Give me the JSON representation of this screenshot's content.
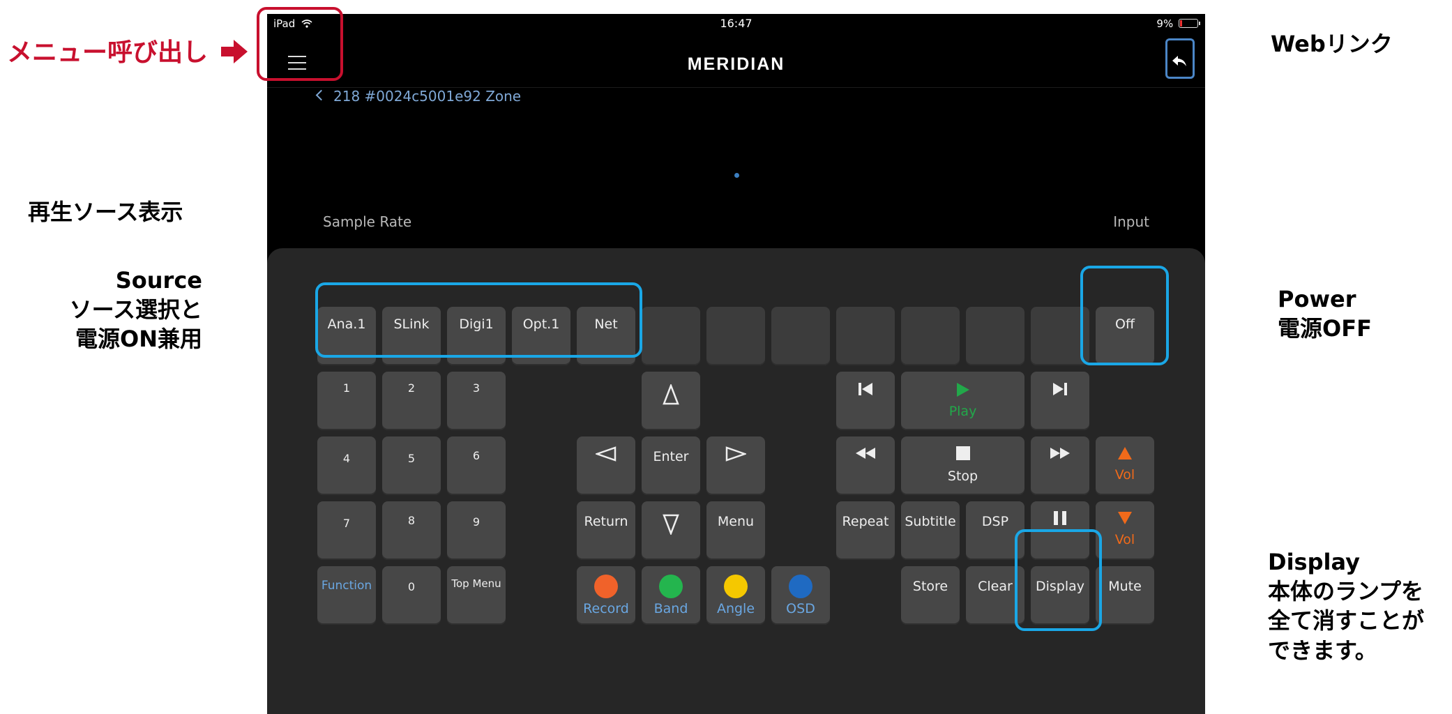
{
  "annotations": {
    "menu": "メニュー呼び出し",
    "web_link": "Webリンク",
    "source_display": "再生ソース表示",
    "source_lines": [
      "Source",
      "ソース選択と",
      "電源ON兼用"
    ],
    "power_lines": [
      "Power",
      "電源OFF"
    ],
    "display_lines": [
      "Display",
      "本体のランプを",
      "全て消すことが",
      "できます。"
    ]
  },
  "status": {
    "device": "iPad",
    "time": "16:47",
    "battery": "9%"
  },
  "navbar": {
    "brand": "MERIDIAN"
  },
  "breadcrumb": "218 #0024c5001e92 Zone",
  "labels": {
    "sample_rate": "Sample Rate",
    "input": "Input"
  },
  "keys": {
    "ana1": "Ana.1",
    "slink": "SLink",
    "digi1": "Digi1",
    "opt1": "Opt.1",
    "net": "Net",
    "off": "Off",
    "n1": "1",
    "n2": "2",
    "n3": "3",
    "n4": "4",
    "n5": "5",
    "n6": "6",
    "n7": "7",
    "n8": "8",
    "n9": "9",
    "n0": "0",
    "function": "Function",
    "top_menu": "Top Menu",
    "enter": "Enter",
    "return": "Return",
    "menu": "Menu",
    "play": "Play",
    "stop": "Stop",
    "vol_up": "Vol",
    "vol_down": "Vol",
    "repeat": "Repeat",
    "subtitle": "Subtitle",
    "dsp": "DSP",
    "store": "Store",
    "clear": "Clear",
    "display": "Display",
    "mute": "Mute",
    "record": "Record",
    "band": "Band",
    "angle": "Angle",
    "osd": "OSD"
  },
  "colors": {
    "highlight": "#1aa7e6",
    "menu_highlight": "#c8102e",
    "play_green": "#22a84a",
    "vol_orange": "#f06a1a",
    "record": "#f0622a",
    "band": "#24b54e",
    "angle": "#f5c800",
    "osd": "#1f6ac2"
  }
}
